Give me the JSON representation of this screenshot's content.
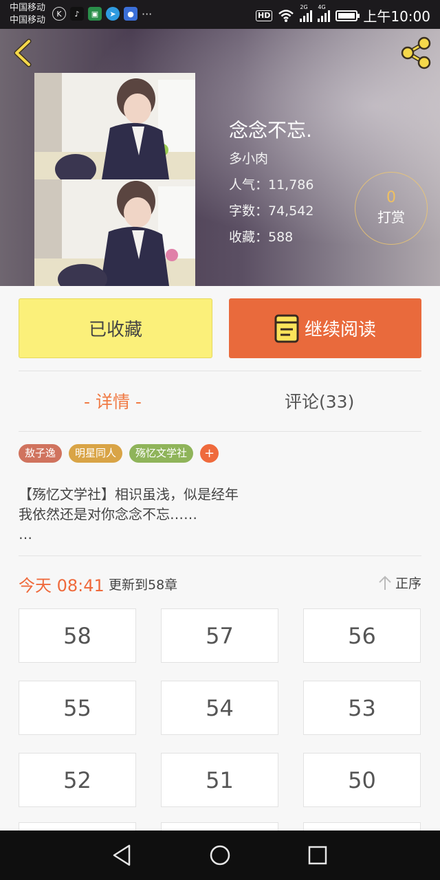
{
  "status_bar": {
    "carrier_1": "中国移动",
    "carrier_2": "中国移动",
    "more": "···",
    "hd": "HD",
    "net_1": "2G",
    "net_2": "4G",
    "time": "上午10:00",
    "app_icons": [
      "k-icon",
      "tiktok-icon",
      "lock-icon",
      "telegram-icon",
      "baidu-paw-icon"
    ]
  },
  "book": {
    "title": "念念不忘.",
    "author": "多小肉",
    "popularity": "人气：11,786",
    "word_count": "字数：74,542",
    "favorites": "收藏：588"
  },
  "reward": {
    "count": "0",
    "label": "打赏"
  },
  "actions": {
    "favorited_label": "已收藏",
    "continue_label": "继续阅读"
  },
  "tabs": {
    "details": "- 详情 -",
    "comments": "评论(33)"
  },
  "tags": [
    {
      "label": "敖子逸",
      "color": "#d0735e"
    },
    {
      "label": "明星同人",
      "color": "#d9a446"
    },
    {
      "label": "殇忆文学社",
      "color": "#8fb45a"
    }
  ],
  "tag_add": "+",
  "synopsis": {
    "line1": "【殇忆文学社】相识虽浅，似是经年",
    "line2": "我依然还是对你念念不忘……",
    "line3": "…"
  },
  "update": {
    "time": "今天 08:41",
    "text": "更新到58章",
    "sort_label": "正序"
  },
  "chapters": [
    "58",
    "57",
    "56",
    "55",
    "54",
    "53",
    "52",
    "51",
    "50"
  ],
  "colors": {
    "accent": "#ef6a3c",
    "favorite_bg": "#fbf07a",
    "reward_gold": "#f0c060"
  }
}
